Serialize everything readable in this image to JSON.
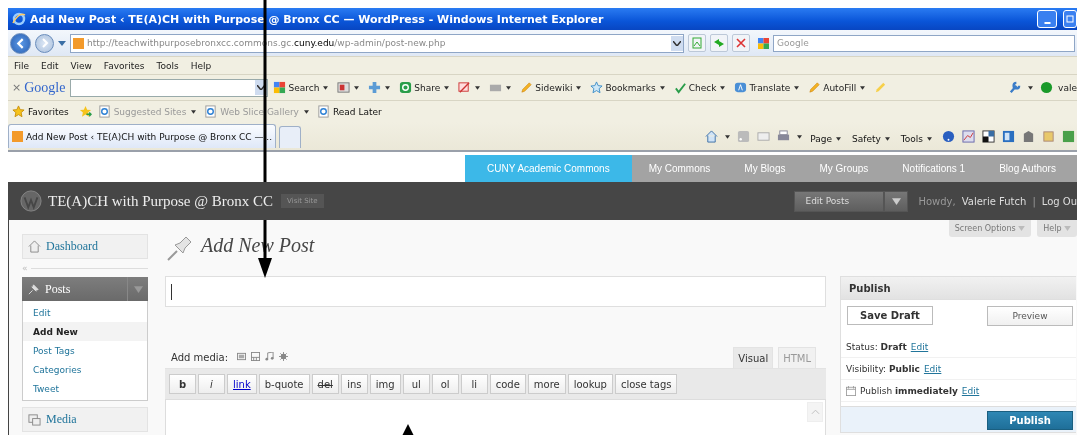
{
  "browser": {
    "title": "Add New Post ‹ TE(A)CH with Purpose @ Bronx CC — WordPress - Windows Internet Explorer",
    "address": {
      "start": "http://teachwithpurposebronxcc.commons.gc.",
      "host": "cuny.edu",
      "path": "/wp-admin/post-new.php"
    },
    "search_placeholder": "Google",
    "menu": [
      "File",
      "Edit",
      "View",
      "Favorites",
      "Tools",
      "Help"
    ],
    "google_toolbar": {
      "close": "×",
      "logo": "Google",
      "items": [
        {
          "label": "Search",
          "kind": "search"
        },
        {
          "kind": "window"
        },
        {
          "kind": "plus"
        },
        {
          "label": "Share",
          "kind": "share"
        },
        {
          "kind": "blocker"
        },
        {
          "kind": "box"
        },
        {
          "label": "Sidewiki",
          "kind": "pencil"
        },
        {
          "label": "Bookmarks",
          "kind": "star"
        },
        {
          "label": "Check",
          "kind": "check"
        },
        {
          "label": "Translate",
          "kind": "translate"
        },
        {
          "label": "AutoFill",
          "kind": "pencil"
        }
      ],
      "user": "vale"
    },
    "favorites": [
      {
        "label": "Favorites",
        "kind": "star",
        "disabled": false
      },
      {
        "label": "Suggested Sites",
        "kind": "ie",
        "disabled": true
      },
      {
        "label": "Web Slice Gallery",
        "kind": "ie",
        "disabled": true
      },
      {
        "label": "Read Later",
        "kind": "ie",
        "disabled": false
      }
    ],
    "tabs": [
      {
        "label": "Add New Post ‹ TE(A)CH with Purpose @ Bronx CC —...",
        "selected": true
      },
      {
        "selected": false
      }
    ],
    "command_bar": [
      "Page",
      "Safety",
      "Tools"
    ]
  },
  "commons_bar": [
    {
      "label": "CUNY Academic Commons",
      "selected": true
    },
    {
      "label": "My Commons",
      "selected": false
    },
    {
      "label": "My Blogs",
      "selected": false
    },
    {
      "label": "My Groups",
      "selected": false
    },
    {
      "label": "Notifications 1",
      "selected": false
    },
    {
      "label": "Blog Authors",
      "selected": false
    }
  ],
  "wp_header": {
    "site_title": "TE(A)CH with Purpose @ Bronx CC",
    "visit_site": "Visit Site",
    "edit_posts": "Edit Posts",
    "howdy": "Howdy,",
    "user": "Valerie Futch",
    "separator": "|",
    "logout": "Log Ou"
  },
  "sidebar": {
    "collapse": "«",
    "items": [
      {
        "label": "Dashboard",
        "expanded": false
      },
      {
        "label": "Posts",
        "expanded": true,
        "children": [
          {
            "label": "Edit",
            "selected": false
          },
          {
            "label": "Add New",
            "selected": true
          },
          {
            "label": "Post Tags",
            "selected": false
          },
          {
            "label": "Categories",
            "selected": false
          },
          {
            "label": "Tweet",
            "selected": false
          }
        ]
      },
      {
        "label": "Media",
        "expanded": false
      }
    ]
  },
  "screen_options": "Screen Options",
  "help": "Help",
  "page_title": "Add New Post",
  "add_media": "Add media:",
  "editor_tabs": [
    {
      "label": "Visual",
      "selected": true
    },
    {
      "label": "HTML",
      "selected": false
    }
  ],
  "quicktags": [
    {
      "label": "b",
      "kind": "bold"
    },
    {
      "label": "i",
      "kind": "italic"
    },
    {
      "label": "link",
      "kind": "link"
    },
    {
      "label": "b-quote",
      "kind": "plain"
    },
    {
      "label": "del",
      "kind": "strike"
    },
    {
      "label": "ins",
      "kind": "plain"
    },
    {
      "label": "img",
      "kind": "plain"
    },
    {
      "label": "ul",
      "kind": "plain"
    },
    {
      "label": "ol",
      "kind": "plain"
    },
    {
      "label": "li",
      "kind": "plain"
    },
    {
      "label": "code",
      "kind": "plain"
    },
    {
      "label": "more",
      "kind": "plain"
    },
    {
      "label": "lookup",
      "kind": "plain"
    },
    {
      "label": "close tags",
      "kind": "plain"
    }
  ],
  "publish": {
    "title": "Publish",
    "save_draft": "Save Draft",
    "preview": "Preview",
    "lines": [
      {
        "text": "Status: **Draft**",
        "link": "Edit",
        "kind": "plain"
      },
      {
        "text": "Visibility: **Public**",
        "link": "Edit",
        "kind": "plain"
      },
      {
        "text": "Publish **immediately**",
        "link": "Edit",
        "kind": "calendar"
      }
    ],
    "button": "Publish"
  },
  "annotations": [
    {
      "kind": "down"
    },
    {
      "kind": "up"
    }
  ]
}
